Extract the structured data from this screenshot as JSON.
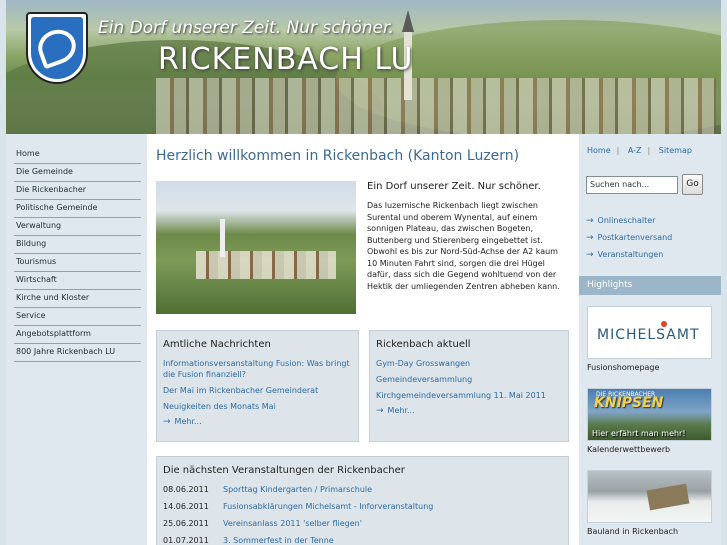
{
  "header": {
    "slogan": "Ein Dorf unserer Zeit. Nur schöner.",
    "site_name": "RICKENBACH LU"
  },
  "leftnav": {
    "items": [
      {
        "label": "Home"
      },
      {
        "label": "Die Gemeinde"
      },
      {
        "label": "Die Rickenbacher"
      },
      {
        "label": "Politische Gemeinde"
      },
      {
        "label": "Verwaltung"
      },
      {
        "label": "Bildung"
      },
      {
        "label": "Tourismus"
      },
      {
        "label": "Wirtschaft"
      },
      {
        "label": "Kirche und Kloster"
      },
      {
        "label": "Service"
      },
      {
        "label": "Angebotsplattform"
      },
      {
        "label": "800 Jahre Rickenbach LU"
      }
    ]
  },
  "main": {
    "title": "Herzlich willkommen in Rickenbach (Kanton Luzern)",
    "lead": "Ein Dorf unserer Zeit. Nur schöner.",
    "text": "Das luzernische Rickenbach liegt zwischen Surental und oberem Wynental, auf einem sonnigen Plateau, das zwischen Bogeten, Buttenberg und Stierenberg eingebettet ist. Obwohl es bis zur Nord-Süd-Achse der A2 kaum 10 Minuten Fahrt sind, sorgen die drei Hügel dafür, dass sich die Gegend wohltuend von der Hektik der umliegenden Zentren abheben kann.",
    "news": {
      "title": "Amtliche Nachrichten",
      "links": [
        "Informationsversanstaltung Fusion: Was bringt die Fusion finanziell?",
        "Der Mai im Rickenbacher Gemeinderat",
        "Neuigkeiten des Monats Mai"
      ],
      "more": "Mehr..."
    },
    "current": {
      "title": "Rickenbach aktuell",
      "links": [
        "Gym-Day Grosswangen",
        "Gemeindeversammlung",
        "Kirchgemeindeversammlung 11. Mai 2011"
      ],
      "more": "Mehr..."
    },
    "events": {
      "title": "Die nächsten Veranstaltungen der Rickenbacher",
      "rows": [
        {
          "date": "08.06.2011",
          "title": "Sporttag Kindergarten / Primarschule"
        },
        {
          "date": "14.06.2011",
          "title": "Fusionsabklärungen Michelsamt - Inforveranstaltung"
        },
        {
          "date": "25.06.2011",
          "title": "Vereinsanlass 2011 'selber fliegen'"
        },
        {
          "date": "01.07.2011",
          "title": "3. Sommerfest in der Tenne"
        }
      ]
    }
  },
  "right": {
    "topnav": {
      "home": "Home",
      "az": "A-Z",
      "sitemap": "Sitemap"
    },
    "search": {
      "placeholder": "Suchen nach...",
      "button": "Go"
    },
    "links": [
      "Onlineschalter",
      "Postkartenversand",
      "Veranstaltungen"
    ],
    "highlights_title": "Highlights",
    "highlights": [
      {
        "caption": "Fusionshomepage",
        "logo_text": "MICHELSAMT"
      },
      {
        "caption": "Kalenderwettbewerb",
        "small_text": "DIE RICKENBACHER",
        "big_text": "KNIPSEN",
        "sub_text": "Hier erfährt man mehr!"
      },
      {
        "caption": "Bauland in Rickenbach"
      }
    ]
  },
  "colors": {
    "link": "#2e6aa0",
    "title": "#3b6a93",
    "panel": "#dde5ea"
  }
}
